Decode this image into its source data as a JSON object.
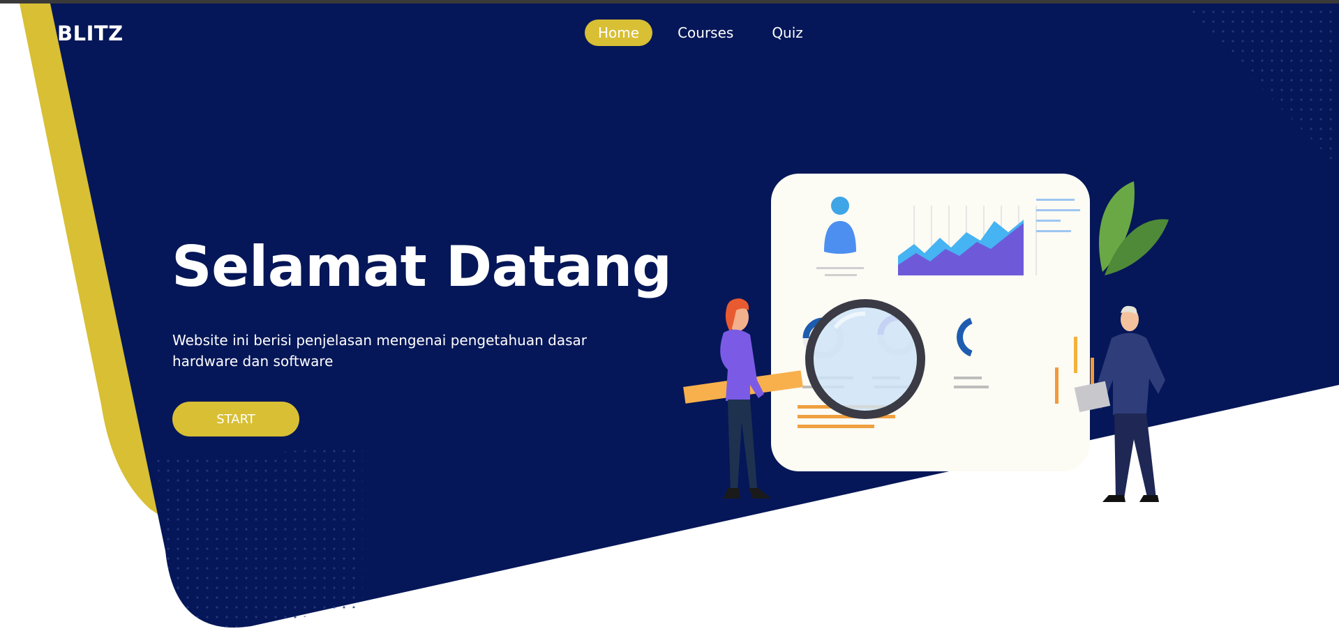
{
  "brand": {
    "name": "BLITZ"
  },
  "nav": {
    "items": [
      {
        "label": "Home",
        "active": true
      },
      {
        "label": "Courses",
        "active": false
      },
      {
        "label": "Quiz",
        "active": false
      }
    ]
  },
  "hero": {
    "title": "Selamat Datang",
    "description": "Website ini berisi penjelasan mengenai pengetahuan dasar hardware dan software",
    "start_label": "START"
  },
  "colors": {
    "navy": "#051758",
    "accent_yellow": "#d8bf34",
    "white": "#ffffff"
  },
  "illustration": {
    "icon": "data-analysis-illustration"
  }
}
